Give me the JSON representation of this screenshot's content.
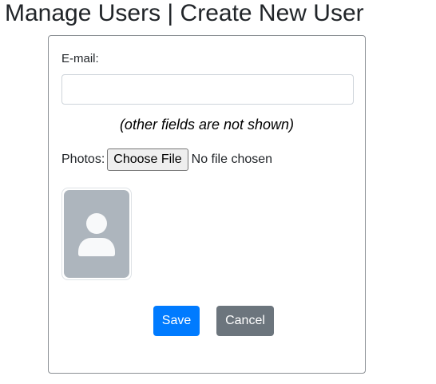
{
  "page": {
    "title": "Manage Users | Create New User"
  },
  "form": {
    "email_label": "E-mail:",
    "email_value": "",
    "email_placeholder": "",
    "note": "(other fields are not shown)",
    "photos_label": "Photos:",
    "file_button_label": "Choose File",
    "file_status": "No file chosen",
    "photo_icon": "user-placeholder-icon",
    "save_label": "Save",
    "cancel_label": "Cancel"
  },
  "colors": {
    "primary": "#007bff",
    "secondary": "#6c757d",
    "placeholder_bg": "#adb5bd",
    "placeholder_fg": "#f8f9fa"
  }
}
